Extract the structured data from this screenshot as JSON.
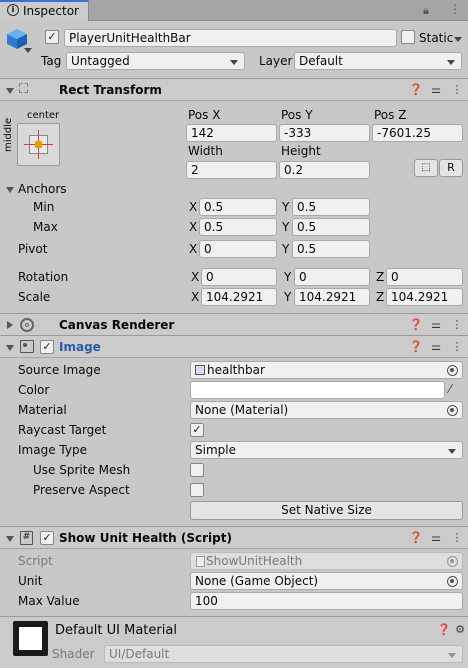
{
  "tab": {
    "title": "Inspector"
  },
  "object": {
    "name": "PlayerUnitHealthBar",
    "static_label": "Static",
    "tag_label": "Tag",
    "tag_value": "Untagged",
    "layer_label": "Layer",
    "layer_value": "Default"
  },
  "rect_transform": {
    "title": "Rect Transform",
    "anchor_h": "center",
    "anchor_v": "middle",
    "pos_x_label": "Pos X",
    "pos_y_label": "Pos Y",
    "pos_z_label": "Pos Z",
    "pos_x": "142",
    "pos_y": "-333",
    "pos_z": "-7601.25",
    "width_label": "Width",
    "height_label": "Height",
    "width": "2",
    "height": "0.2",
    "r_button": "R",
    "anchors_label": "Anchors",
    "min_label": "Min",
    "min_x": "0.5",
    "min_y": "0.5",
    "max_label": "Max",
    "max_x": "0.5",
    "max_y": "0.5",
    "pivot_label": "Pivot",
    "pivot_x": "0",
    "pivot_y": "0.5",
    "rotation_label": "Rotation",
    "rot_x": "0",
    "rot_y": "0",
    "rot_z": "0",
    "scale_label": "Scale",
    "scale_x": "104.2921",
    "scale_y": "104.2921",
    "scale_z": "104.2921",
    "x": "X",
    "y": "Y",
    "z": "Z"
  },
  "canvas_renderer": {
    "title": "Canvas Renderer"
  },
  "image": {
    "title": "Image",
    "source_image_label": "Source Image",
    "source_image": "healthbar",
    "color_label": "Color",
    "material_label": "Material",
    "material": "None (Material)",
    "raycast_label": "Raycast Target",
    "image_type_label": "Image Type",
    "image_type": "Simple",
    "use_sprite_mesh_label": "Use Sprite Mesh",
    "preserve_aspect_label": "Preserve Aspect",
    "set_native_size": "Set Native Size"
  },
  "script_comp": {
    "title": "Show Unit Health (Script)",
    "script_label": "Script",
    "script": "ShowUnitHealth",
    "unit_label": "Unit",
    "unit": "None (Game Object)",
    "max_value_label": "Max Value",
    "max_value": "100"
  },
  "material_footer": {
    "title": "Default UI Material",
    "shader_label": "Shader",
    "shader": "UI/Default"
  },
  "colors": {
    "accent_blue": "#2a5ba8",
    "cube_blue": "#3c8ce0",
    "panel": "#c8c8c8"
  }
}
